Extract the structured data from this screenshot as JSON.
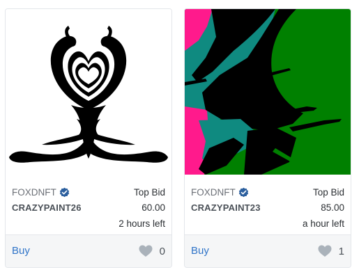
{
  "cards": [
    {
      "collection": "FOXDNFT",
      "name": "CRAZYPAINT26",
      "bid_label": "Top Bid",
      "bid_value": "60.00",
      "time_left": "2 hours left",
      "buy_label": "Buy",
      "likes": "0",
      "art_icon": "symmetric-black-ink-artwork"
    },
    {
      "collection": "FOXDNFT",
      "name": "CRAZYPAINT23",
      "bid_label": "Top Bid",
      "bid_value": "85.00",
      "time_left": "a hour left",
      "buy_label": "Buy",
      "likes": "1",
      "art_icon": "abstract-green-pink-teal-artwork"
    }
  ],
  "colors": {
    "link": "#2f74c8",
    "verified_badge": "#2c5f9e",
    "heart": "#aab2ba",
    "art_green": "#008000",
    "art_pink": "#ff1a8c",
    "art_teal": "#0f8a80"
  }
}
